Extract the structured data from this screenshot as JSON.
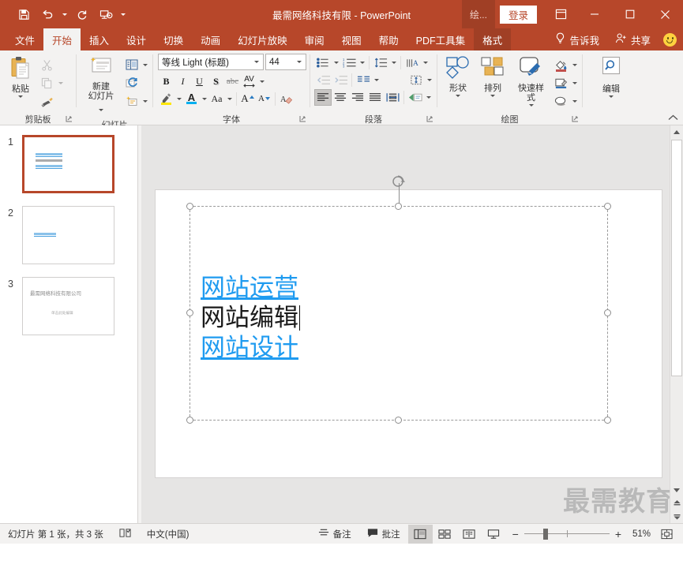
{
  "titlebar": {
    "doc_title": "最需网络科技有限  -  PowerPoint",
    "qat": [
      {
        "name": "save-icon",
        "tooltip": "保存"
      },
      {
        "name": "undo-icon",
        "tooltip": "撤销"
      },
      {
        "name": "redo-icon",
        "tooltip": "恢复"
      },
      {
        "name": "start-slideshow-icon",
        "tooltip": "从头开始"
      },
      {
        "name": "customize-qat-icon",
        "tooltip": "自定义快速访问工具栏"
      }
    ],
    "draw_tab": "绘...",
    "signin": "登录",
    "ribbon_display": "功能区显示选项",
    "minimize": "最小化",
    "maximize": "最大化",
    "close": "关闭"
  },
  "tabs": [
    {
      "label": "文件",
      "active": false
    },
    {
      "label": "开始",
      "active": true
    },
    {
      "label": "插入",
      "active": false
    },
    {
      "label": "设计",
      "active": false
    },
    {
      "label": "切换",
      "active": false
    },
    {
      "label": "动画",
      "active": false
    },
    {
      "label": "幻灯片放映",
      "active": false
    },
    {
      "label": "审阅",
      "active": false
    },
    {
      "label": "视图",
      "active": false
    },
    {
      "label": "帮助",
      "active": false
    },
    {
      "label": "PDF工具集",
      "active": false
    },
    {
      "label": "格式",
      "active": false,
      "contextual": true
    }
  ],
  "menu_right": {
    "tellme": "告诉我",
    "share": "共享",
    "smiley": "反馈"
  },
  "ribbon": {
    "clipboard": {
      "label": "剪贴板",
      "paste": "粘贴",
      "cut": "剪切",
      "copy": "复制",
      "format_painter": "格式刷"
    },
    "slides": {
      "label": "幻灯片",
      "new_slide": "新建\n幻灯片",
      "new_slide_l1": "新建",
      "new_slide_l2": "幻灯片",
      "layout": "版式",
      "reset": "重置",
      "section": "节"
    },
    "font": {
      "label": "字体",
      "font_name": "等线 Light (标题)",
      "font_size": "44",
      "bold": "B",
      "italic": "I",
      "underline": "U",
      "shadow": "S",
      "strikethrough": "abc",
      "spacing": "AV",
      "highlight": "文本突出显示颜色",
      "font_color": "字体颜色",
      "change_case": "Aa",
      "increase_size": "A",
      "decrease_size": "A",
      "clear_format": "清除所有格式"
    },
    "paragraph": {
      "label": "段落",
      "bullets": "项目符号",
      "numbering": "编号",
      "line_spacing": "行距",
      "text_direction": "文字方向",
      "decrease_indent": "减少缩进量",
      "increase_indent": "增加缩进量",
      "columns": "分栏",
      "align_text": "对齐文本",
      "align_left": "左对齐",
      "align_center": "居中",
      "align_right": "右对齐",
      "justify": "两端对齐",
      "distribute": "分散对齐",
      "smartart": "转换为 SmartArt"
    },
    "drawing": {
      "label": "绘图",
      "shapes": "形状",
      "arrange": "排列",
      "quick_styles": "快速样式",
      "shape_fill": "形状填充",
      "shape_outline": "形状轮廓",
      "shape_effects": "形状效果"
    },
    "editing": {
      "label": "",
      "edit": "编辑"
    },
    "collapse": "折叠功能区"
  },
  "thumbnails": [
    {
      "number": "1",
      "selected": true,
      "lines": [
        "网站运营",
        "网站编辑",
        "网站设计"
      ]
    },
    {
      "number": "2",
      "selected": false,
      "lines": [
        "最需要大王"
      ]
    },
    {
      "number": "3",
      "selected": false,
      "title": "最需网络科技有限公司",
      "subtitle": "单击此处编辑"
    }
  ],
  "slide": {
    "lines": [
      {
        "text": "网站运营",
        "style": "link"
      },
      {
        "text": "网站编辑",
        "style": "plain",
        "cursor": true
      },
      {
        "text": "网站设计",
        "style": "link"
      }
    ],
    "link_color": "#1f9bf0",
    "text_color": "#1a1a1a"
  },
  "watermark": "最需教育",
  "statusbar": {
    "slide_count": "幻灯片 第 1 张，共 3 张",
    "spellcheck": "拼写检查",
    "language": "中文(中国)",
    "notes": "备注",
    "comments": "批注",
    "views": [
      {
        "name": "normal-view",
        "label": "普通视图",
        "active": true
      },
      {
        "name": "slide-sorter-view",
        "label": "幻灯片浏览",
        "active": false
      },
      {
        "name": "reading-view",
        "label": "阅读视图",
        "active": false
      },
      {
        "name": "slideshow-view",
        "label": "幻灯片放映",
        "active": false
      }
    ],
    "zoom_out": "−",
    "zoom_in": "+",
    "zoom_level": "51%",
    "fit_window": "适应窗口大小"
  },
  "colors": {
    "accent": "#b7472a",
    "accent_dark": "#a03f25",
    "ribbon_bg": "#f3f2f1",
    "workspace_bg": "#e6e5e4"
  }
}
